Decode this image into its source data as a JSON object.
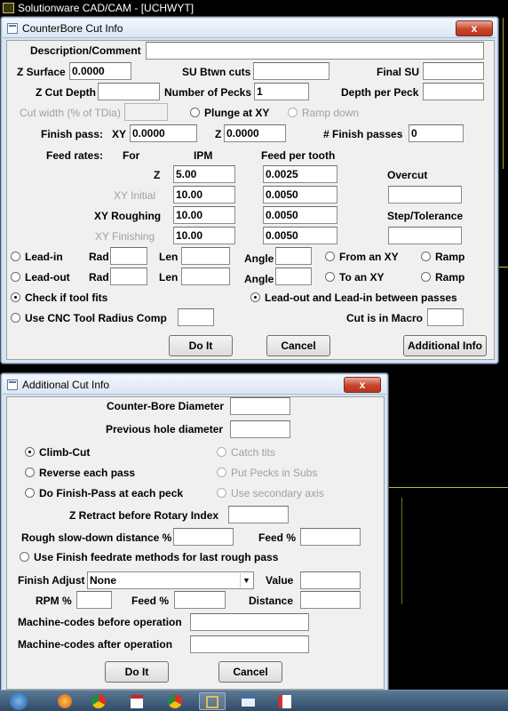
{
  "app_title": "Solutionware CAD/CAM - [UCHWYT]",
  "main": {
    "title": "CounterBore Cut Info",
    "close_glyph": "x",
    "description_label": "Description/Comment",
    "z_surface_label": "Z Surface",
    "z_surface_value": "0.0000",
    "su_btwn_cuts_label": "SU Btwn cuts",
    "final_su_label": "Final SU",
    "z_cut_depth_label": "Z Cut Depth",
    "number_of_pecks_label": "Number of Pecks",
    "number_of_pecks_value": "1",
    "depth_per_peck_label": "Depth per Peck",
    "cut_width_label": "Cut width (% of TDia)",
    "plunge_label": "Plunge at XY",
    "ramp_down_label": "Ramp down",
    "finish_pass_label": "Finish pass:",
    "xy_label": "XY",
    "xy_value": "0.0000",
    "z_label": "Z",
    "z_value": "0.0000",
    "num_finish_label": "# Finish passes",
    "num_finish_value": "0",
    "feed_rates_label": "Feed rates:",
    "for_label": "For",
    "ipm_label": "IPM",
    "feed_tooth_label": "Feed per tooth",
    "overcut_label": "Overcut",
    "step_tol_label": "Step/Tolerance",
    "feed_rows": [
      {
        "label": "Z",
        "ipm": "5.00",
        "fpt": "0.0025"
      },
      {
        "label": "XY Initial",
        "ipm": "10.00",
        "fpt": "0.0050"
      },
      {
        "label": "XY Roughing",
        "ipm": "10.00",
        "fpt": "0.0050"
      },
      {
        "label": "XY Finishing",
        "ipm": "10.00",
        "fpt": "0.0050"
      }
    ],
    "lead_in_label": "Lead-in",
    "lead_out_label": "Lead-out",
    "rad_label": "Rad",
    "len_label": "Len",
    "angle_label": "Angle",
    "from_xy_label": "From an XY",
    "to_xy_label": "To an XY",
    "ramp_label": "Ramp",
    "check_tool_label": "Check if tool fits",
    "lead_between_label": "Lead-out and Lead-in between passes",
    "cnc_comp_label": "Use CNC Tool Radius Comp",
    "cut_macro_label": "Cut is in Macro",
    "do_it_label": "Do It",
    "cancel_label": "Cancel",
    "additional_label": "Additional Info"
  },
  "additional": {
    "title": "Additional Cut Info",
    "close_glyph": "x",
    "cb_diameter_label": "Counter-Bore Diameter",
    "prev_hole_label": "Previous hole diameter",
    "climb_cut_label": "Climb-Cut",
    "catch_tits_label": "Catch tits",
    "reverse_label": "Reverse each pass",
    "put_pecks_label": "Put Pecks in Subs",
    "finish_each_label": "Do Finish-Pass at each peck",
    "secondary_axis_label": "Use secondary axis",
    "z_retract_label": "Z Retract before Rotary Index",
    "rough_slow_label": "Rough slow-down distance %",
    "feed_pct_label": "Feed %",
    "use_finish_label": "Use Finish feedrate methods for last rough pass",
    "finish_adjust_label": "Finish Adjust",
    "finish_adjust_value": "None",
    "value_label": "Value",
    "rpm_label": "RPM %",
    "distance_label": "Distance",
    "mc_before_label": "Machine-codes before operation",
    "mc_after_label": "Machine-codes after operation",
    "do_it_label": "Do It",
    "cancel_label": "Cancel"
  },
  "taskbar": {
    "icons": [
      "start-icon",
      "firefox-icon",
      "chrome-icon",
      "calendar-icon",
      "chrome-icon",
      "cad-icon",
      "window-icon",
      "app-icon"
    ]
  }
}
